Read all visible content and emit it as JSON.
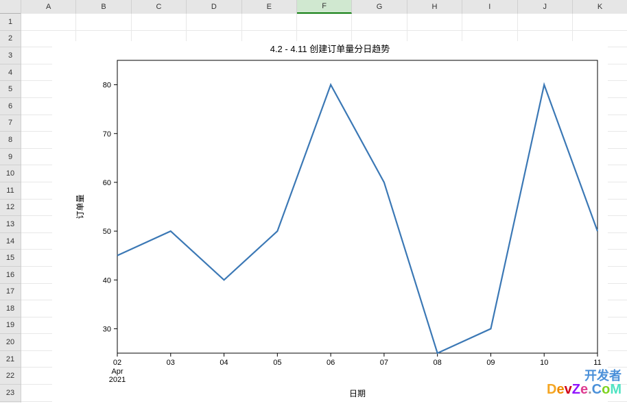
{
  "spreadsheet": {
    "columns": [
      "A",
      "B",
      "C",
      "D",
      "E",
      "F",
      "G",
      "H",
      "I",
      "J",
      "K"
    ],
    "selected_column": "F",
    "row_count": 23
  },
  "watermark": {
    "line1": "开发者",
    "line2": "DevZe.CoM"
  },
  "chart_data": {
    "type": "line",
    "title": "4.2 - 4.11 创建订单量分日趋势",
    "xlabel": "日期",
    "ylabel": "订单量",
    "x_ticks": [
      "02",
      "03",
      "04",
      "05",
      "06",
      "07",
      "08",
      "09",
      "10",
      "11"
    ],
    "x_sublabels": [
      "Apr",
      "2021"
    ],
    "y_ticks": [
      30,
      40,
      50,
      60,
      70,
      80
    ],
    "ylim": [
      25,
      85
    ],
    "categories": [
      "02",
      "03",
      "04",
      "05",
      "06",
      "07",
      "08",
      "09",
      "10",
      "11"
    ],
    "values": [
      45,
      50,
      40,
      50,
      80,
      60,
      25,
      30,
      80,
      50
    ],
    "line_color": "#3b78b5"
  }
}
